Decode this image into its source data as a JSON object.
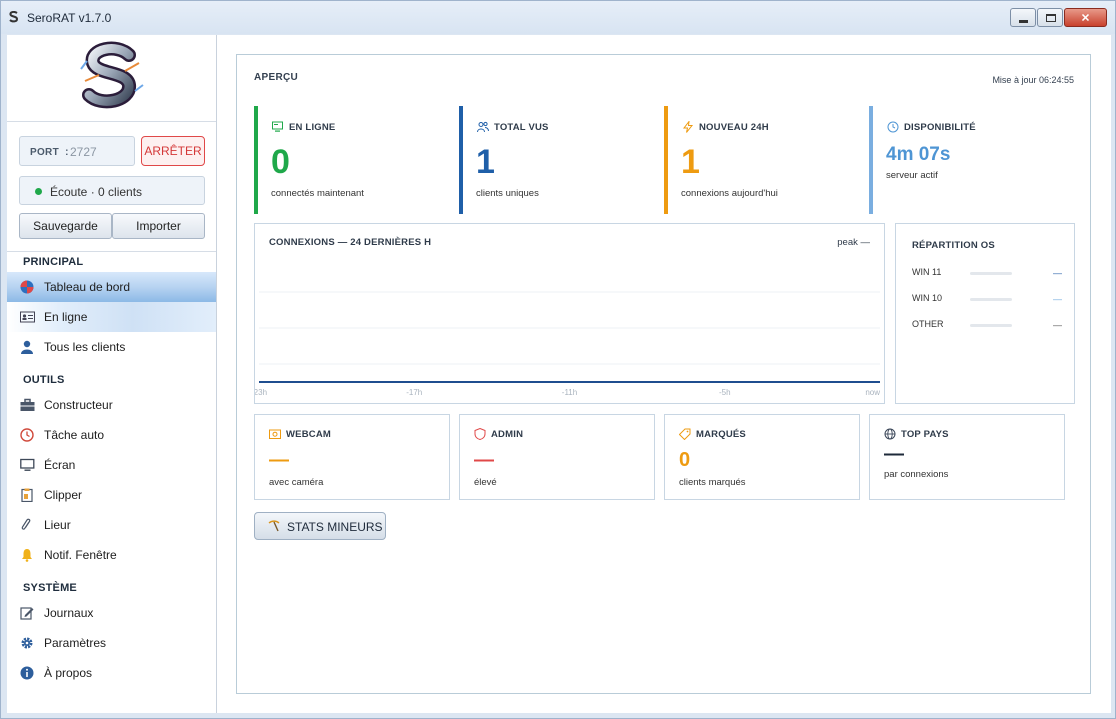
{
  "window": {
    "title": "SeroRAT v1.7.0",
    "icon": "app-logo-icon"
  },
  "sidebar": {
    "port_label": "PORT",
    "port_sep": ":",
    "port_value": "2727",
    "stop_label": "ARRÊTER",
    "status_text": "Écoute  ·  0 clients",
    "save_label": "Sauvegarde",
    "import_label": "Importer",
    "sections": {
      "principal": "PRINCIPAL",
      "outils": "OUTILS",
      "systeme": "SYSTÈME"
    },
    "nav": {
      "dashboard": "Tableau de bord",
      "online": "En ligne",
      "all_clients": "Tous les clients",
      "builder": "Constructeur",
      "auto_task": "Tâche auto",
      "screen": "Écran",
      "clipper": "Clipper",
      "binder": "Lieur",
      "window_notif": "Notif. Fenêtre",
      "logs": "Journaux",
      "settings": "Paramètres",
      "about": "À propos"
    }
  },
  "main": {
    "heading": "APERÇU",
    "updated": "Mise à jour 06:24:55",
    "kpis": {
      "online": {
        "title": "EN LIGNE",
        "value": "0",
        "sub": "connectés maintenant",
        "color": "#1fa84a"
      },
      "total": {
        "title": "TOTAL VUS",
        "value": "1",
        "sub": "clients uniques",
        "color": "#1f5fa8"
      },
      "new24": {
        "title": "NOUVEAU 24H",
        "value": "1",
        "sub": "connexions aujourd'hui",
        "color": "#ee9b11"
      },
      "uptime": {
        "title": "DISPONIBILITÉ",
        "value": "4m 07s",
        "sub": "serveur actif",
        "color": "#4e95d4"
      }
    },
    "chart": {
      "title": "CONNEXIONS — 24 DERNIÈRES H",
      "peak": "peak —",
      "ticks": [
        "-23h",
        "-17h",
        "-11h",
        "-5h",
        "now"
      ]
    },
    "os": {
      "title": "RÉPARTITION OS",
      "rows": [
        {
          "name": "WIN 11",
          "value": "—"
        },
        {
          "name": "WIN 10",
          "value": "—"
        },
        {
          "name": "OTHER",
          "value": "—"
        }
      ]
    },
    "cards": {
      "webcam": {
        "title": "WEBCAM",
        "value": "—",
        "sub": "avec caméra",
        "color": "#ee9b11"
      },
      "admin": {
        "title": "ADMIN",
        "value": "—",
        "sub": "élevé",
        "color": "#e04848"
      },
      "tagged": {
        "title": "MARQUÉS",
        "value": "0",
        "sub": "clients marqués",
        "color": "#ee9b11"
      },
      "top_country": {
        "title": "TOP PAYS",
        "value": "—",
        "sub": "par connexions",
        "color": "#1e2a3a"
      }
    },
    "miner_button": "STATS MINEURS"
  },
  "chart_data": {
    "type": "line",
    "title": "CONNEXIONS — 24 DERNIÈRES H",
    "categories": [
      "-23h",
      "-17h",
      "-11h",
      "-5h",
      "now"
    ],
    "series": [
      {
        "values": [
          0,
          0,
          0,
          0,
          0
        ]
      }
    ]
  }
}
